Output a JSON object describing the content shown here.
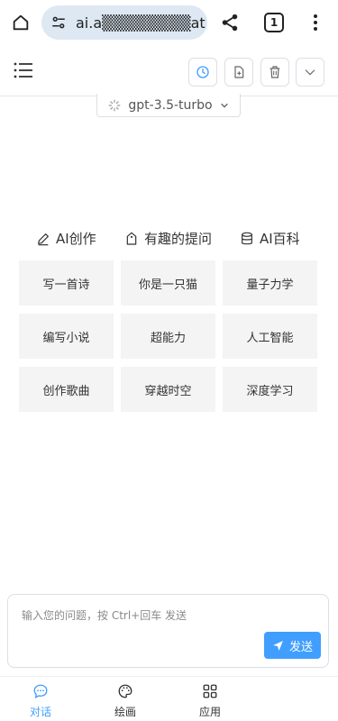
{
  "browser": {
    "url": "ai.a▒▒▒▒▒▒▒▒at",
    "tab_count": "1"
  },
  "header": {
    "buttons": [
      "history-icon",
      "new-chat-icon",
      "delete-icon",
      "collapse-icon"
    ]
  },
  "model_selector": {
    "value": "gpt-3.5-turbo"
  },
  "categories": [
    {
      "label": "AI创作",
      "icon": "pen-icon"
    },
    {
      "label": "有趣的提问",
      "icon": "tag-icon"
    },
    {
      "label": "AI百科",
      "icon": "database-icon"
    }
  ],
  "prompts": [
    "写一首诗",
    "你是一只猫",
    "量子力学",
    "编写小说",
    "超能力",
    "人工智能",
    "创作歌曲",
    "穿越时空",
    "深度学习"
  ],
  "input": {
    "placeholder": "输入您的问题，按 Ctrl+回车 发送",
    "send_label": "发送"
  },
  "bottom_nav": [
    {
      "label": "对话",
      "icon": "chat-icon",
      "active": true
    },
    {
      "label": "绘画",
      "icon": "palette-icon",
      "active": false
    },
    {
      "label": "应用",
      "icon": "apps-icon",
      "active": false
    }
  ],
  "colors": {
    "accent": "#409eff",
    "card_bg": "#f4f4f5",
    "url_bar_bg": "#dde8f3"
  }
}
